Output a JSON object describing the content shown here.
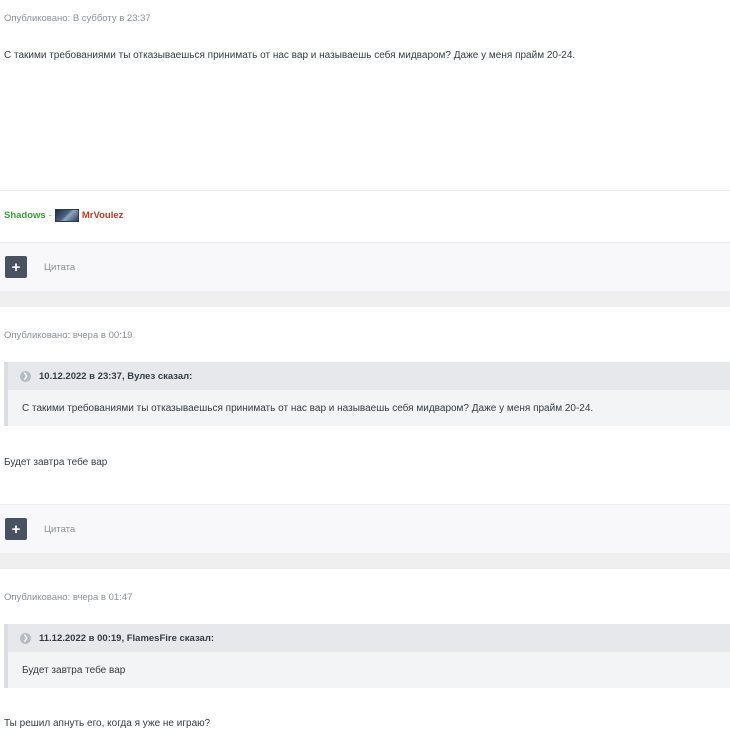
{
  "post1": {
    "meta": "Опубликовано: В субботу в 23:37",
    "text": "С такими требованиями ты отказываешься принимать от нас вар и называешь себя мидваром? Даже у меня прайм 20-24.",
    "signature": {
      "group": "Shadows",
      "sep": "-",
      "name": "MrVoulez"
    },
    "quote_label": "Цитата"
  },
  "post2": {
    "meta": "Опубликовано: вчера в 00:19",
    "quote_header": "10.12.2022 в 23:37, Вулез сказал:",
    "quote_text": "С такими требованиями ты отказываешься принимать от нас вар и называешь себя мидваром? Даже у меня прайм 20-24.",
    "text": "Будет завтра тебе вар",
    "quote_label": "Цитата"
  },
  "post3": {
    "meta": "Опубликовано: вчера в 01:47",
    "quote_header": "11.12.2022 в 00:19, FlamesFire сказал:",
    "quote_text": "Будет завтра тебе вар",
    "text": "Ты решил апнуть его, когда я уже не играю?"
  },
  "icons": {
    "plus": "plus-icon",
    "quote": "quote-icon",
    "avatar": "rank-image"
  },
  "colors": {
    "signature_group": "#3d9b3d",
    "signature_name": "#c0392b"
  }
}
